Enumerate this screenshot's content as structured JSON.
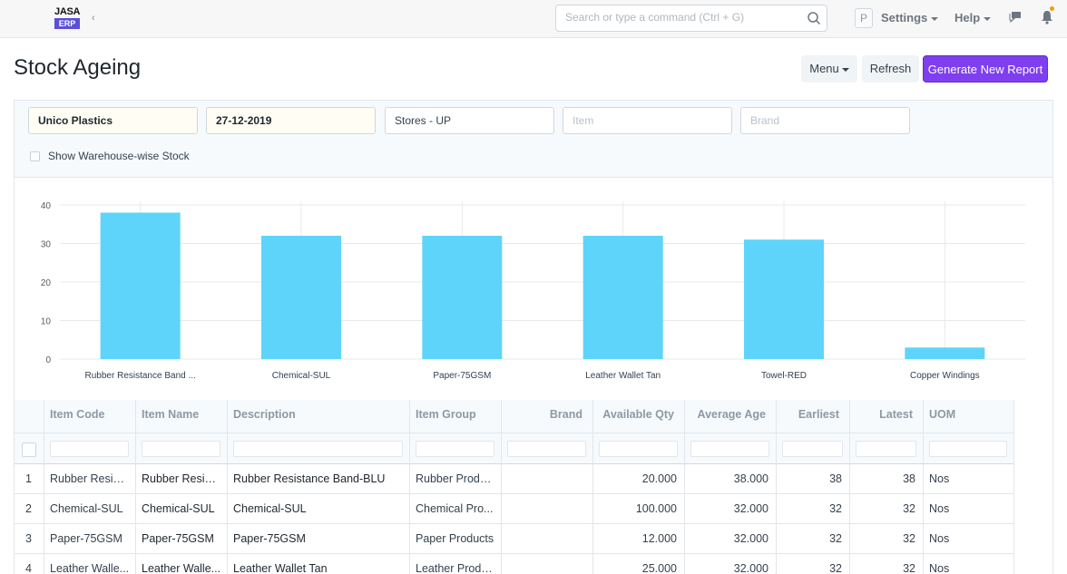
{
  "navbar": {
    "logo_top": "JASA",
    "logo_bottom": "ERP",
    "search_placeholder": "Search or type a command (Ctrl + G)",
    "avatar_letter": "P",
    "settings_label": "Settings",
    "help_label": "Help",
    "icons": [
      "search-icon",
      "chat-icon",
      "bell-icon"
    ],
    "notification_color": "#f39c12"
  },
  "page": {
    "title": "Stock Ageing",
    "menu_label": "Menu",
    "refresh_label": "Refresh",
    "generate_label": "Generate New Report",
    "primary_color": "#7f3ef0"
  },
  "filters": {
    "company": "Unico Plastics",
    "date": "27-12-2019",
    "warehouse": "Stores - UP",
    "item_placeholder": "Item",
    "brand_placeholder": "Brand",
    "show_warehouse_label": "Show Warehouse-wise Stock"
  },
  "chart_data": {
    "type": "bar",
    "categories": [
      "Rubber Resistance Band ...",
      "Chemical-SUL",
      "Paper-75GSM",
      "Leather Wallet Tan",
      "Towel-RED",
      "Copper Windings"
    ],
    "values": [
      38,
      32,
      32,
      32,
      31,
      3
    ],
    "ylim": [
      0,
      40
    ],
    "yticks": [
      0,
      10,
      20,
      30,
      40
    ],
    "color": "#5ed4fa",
    "grid": true
  },
  "table": {
    "columns": [
      "Item Code",
      "Item Name",
      "Description",
      "Item Group",
      "Brand",
      "Available Qty",
      "Average Age",
      "Earliest",
      "Latest",
      "UOM"
    ],
    "rows": [
      [
        "1",
        "Rubber Resist...",
        "Rubber Resist...",
        "Rubber Resistance Band-BLU",
        "Rubber Produ...",
        "",
        "20.000",
        "38.000",
        "38",
        "38",
        "Nos"
      ],
      [
        "2",
        "Chemical-SUL",
        "Chemical-SUL",
        "Chemical-SUL",
        "Chemical Pro...",
        "",
        "100.000",
        "32.000",
        "32",
        "32",
        "Nos"
      ],
      [
        "3",
        "Paper-75GSM",
        "Paper-75GSM",
        "Paper-75GSM",
        "Paper Products",
        "",
        "12.000",
        "32.000",
        "32",
        "32",
        "Nos"
      ],
      [
        "4",
        "Leather Walle...",
        "Leather Walle...",
        "Leather Wallet Tan",
        "Leather Produ...",
        "",
        "25.000",
        "32.000",
        "32",
        "32",
        "Nos"
      ]
    ]
  }
}
